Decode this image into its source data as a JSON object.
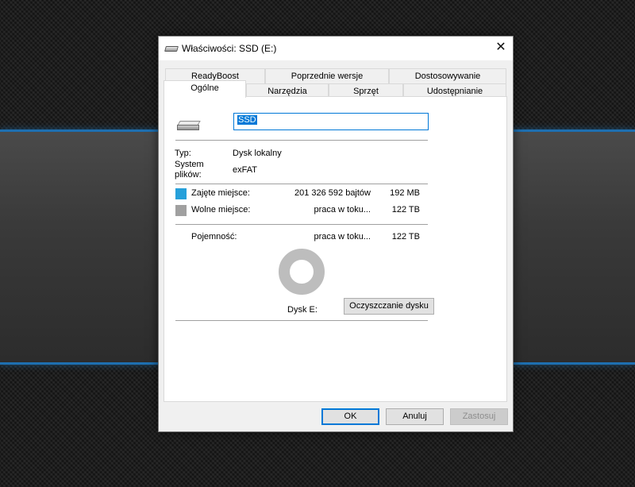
{
  "window": {
    "title": "Właściwości: SSD (E:)",
    "close_glyph": "✕"
  },
  "tabs_back": [
    {
      "label": "ReadyBoost"
    },
    {
      "label": "Poprzednie wersje"
    },
    {
      "label": "Dostosowywanie"
    }
  ],
  "tabs_front": [
    {
      "label": "Ogólne",
      "active": true
    },
    {
      "label": "Narzędzia"
    },
    {
      "label": "Sprzęt"
    },
    {
      "label": "Udostępnianie"
    }
  ],
  "general": {
    "drive_icon": "drive-icon",
    "name_value": "SSD",
    "type_label": "Typ:",
    "type_value": "Dysk lokalny",
    "fs_label_line1": "System",
    "fs_label_line2": "plików:",
    "fs_value": "exFAT",
    "used": {
      "label": "Zajęte miejsce:",
      "bytes": "201 326 592 bajtów",
      "size": "192 MB",
      "color": "#26a0da"
    },
    "free": {
      "label": "Wolne miejsce:",
      "bytes": "praca w toku...",
      "size": "122 TB",
      "color": "#a0a0a0"
    },
    "capacity": {
      "label": "Pojemność:",
      "bytes": "praca w toku...",
      "size": "122 TB"
    },
    "drive_caption": "Dysk E:",
    "cleanup_label": "Oczyszczanie dysku"
  },
  "footer": {
    "ok_label": "OK",
    "cancel_label": "Anuluj",
    "apply_label": "Zastosuj"
  }
}
